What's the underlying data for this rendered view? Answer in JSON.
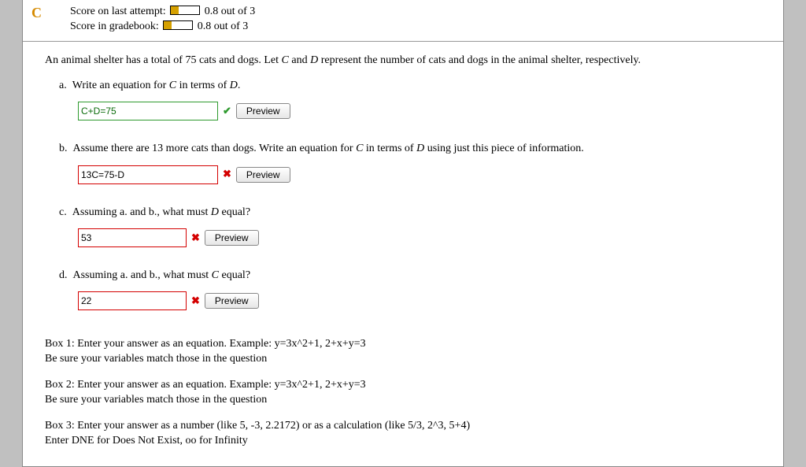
{
  "reload_glyph": "C",
  "score": {
    "last_label": "Score on last attempt:",
    "last_value": "0.8 out of 3",
    "book_label": "Score in gradebook:",
    "book_value": "0.8 out of 3",
    "fill_pct": 26.7
  },
  "prompt": {
    "lead": "An animal shelter has a total of 75 cats and dogs. Let ",
    "c": "C",
    "mid1": " and ",
    "d": "D",
    "tail": " represent the number of cats and dogs in the animal shelter, respectively."
  },
  "parts": {
    "a": {
      "letter": "a.",
      "lead": "Write an equation for ",
      "c": "C",
      "mid": " in terms of ",
      "d": "D",
      "tail": ".",
      "answer": "C+D=75",
      "preview": "Preview",
      "mark": "✔"
    },
    "b": {
      "letter": "b.",
      "lead": "Assume there are 13 more cats than dogs. Write an equation for ",
      "c": "C",
      "mid": " in terms of ",
      "d": "D",
      "tail": " using just this piece of information.",
      "answer": "13C=75-D",
      "preview": "Preview",
      "mark": "✖"
    },
    "c": {
      "letter": "c.",
      "lead": "Assuming a. and b., what must ",
      "d": "D",
      "tail": " equal?",
      "answer": "53",
      "preview": "Preview",
      "mark": "✖"
    },
    "d": {
      "letter": "d.",
      "lead": "Assuming a. and b., what must ",
      "c": "C",
      "tail": " equal?",
      "answer": "22",
      "preview": "Preview",
      "mark": "✖"
    }
  },
  "hints": {
    "h1a": "Box 1: Enter your answer as an equation. Example: y=3x^2+1, 2+x+y=3",
    "h1b": "Be sure your variables match those in the question",
    "h2a": "Box 2: Enter your answer as an equation. Example: y=3x^2+1, 2+x+y=3",
    "h2b": "Be sure your variables match those in the question",
    "h3a": "Box 3: Enter your answer as a number (like 5, -3, 2.2172) or as a calculation (like 5/3, 2^3, 5+4)",
    "h3b": "Enter DNE for Does Not Exist, oo for Infinity"
  }
}
